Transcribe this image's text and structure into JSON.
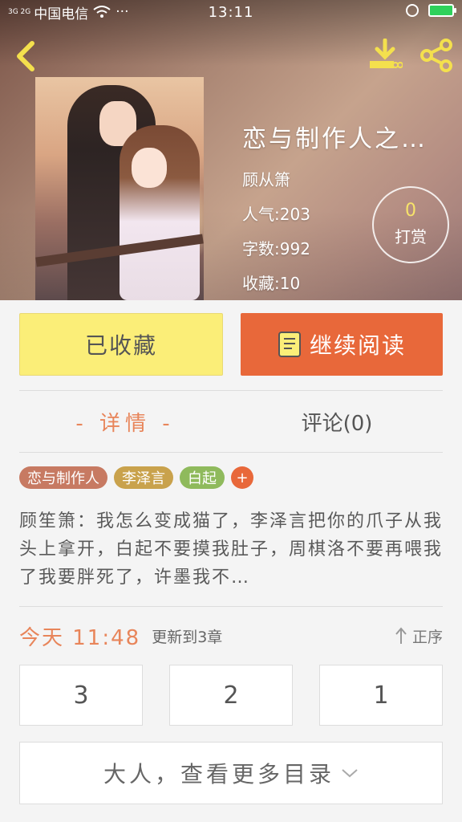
{
  "status_bar": {
    "signal": "3G 2G",
    "carrier": "中国电信",
    "dots": "···",
    "time": "13:11"
  },
  "book": {
    "title": "恋与制作人之…",
    "author": "顾从箫",
    "popularity_label": "人气:",
    "popularity": "203",
    "words_label": "字数:",
    "words": "992",
    "favorites_label": "收藏:",
    "favorites": "10"
  },
  "tip": {
    "count": "0",
    "label": "打赏"
  },
  "actions": {
    "favorite_label": "已收藏",
    "read_label": "继续阅读"
  },
  "tabs": [
    {
      "label": "- 详情 -",
      "active": true
    },
    {
      "label": "评论(0)",
      "active": false
    }
  ],
  "tags": [
    {
      "label": "恋与制作人",
      "color": "#c77a62"
    },
    {
      "label": "李泽言",
      "color": "#c9a24c"
    },
    {
      "label": "白起",
      "color": "#8fba5c"
    },
    {
      "label": "+",
      "color": "#e8683a"
    }
  ],
  "description": "顾笙箫：我怎么变成猫了，李泽言把你的爪子从我头上拿开，白起不要摸我肚子，周棋洛不要再喂我了我要胖死了，许墨我不…",
  "update": {
    "when": "今天 11:48",
    "chapter": "更新到3章",
    "order_label": "正序"
  },
  "chapters": [
    "3",
    "2",
    "1"
  ],
  "more_label": "大人，查看更多目录",
  "colors": {
    "accent": "#e8683a",
    "favorite_bg": "#fbee78",
    "tab_active": "#e8855a"
  }
}
